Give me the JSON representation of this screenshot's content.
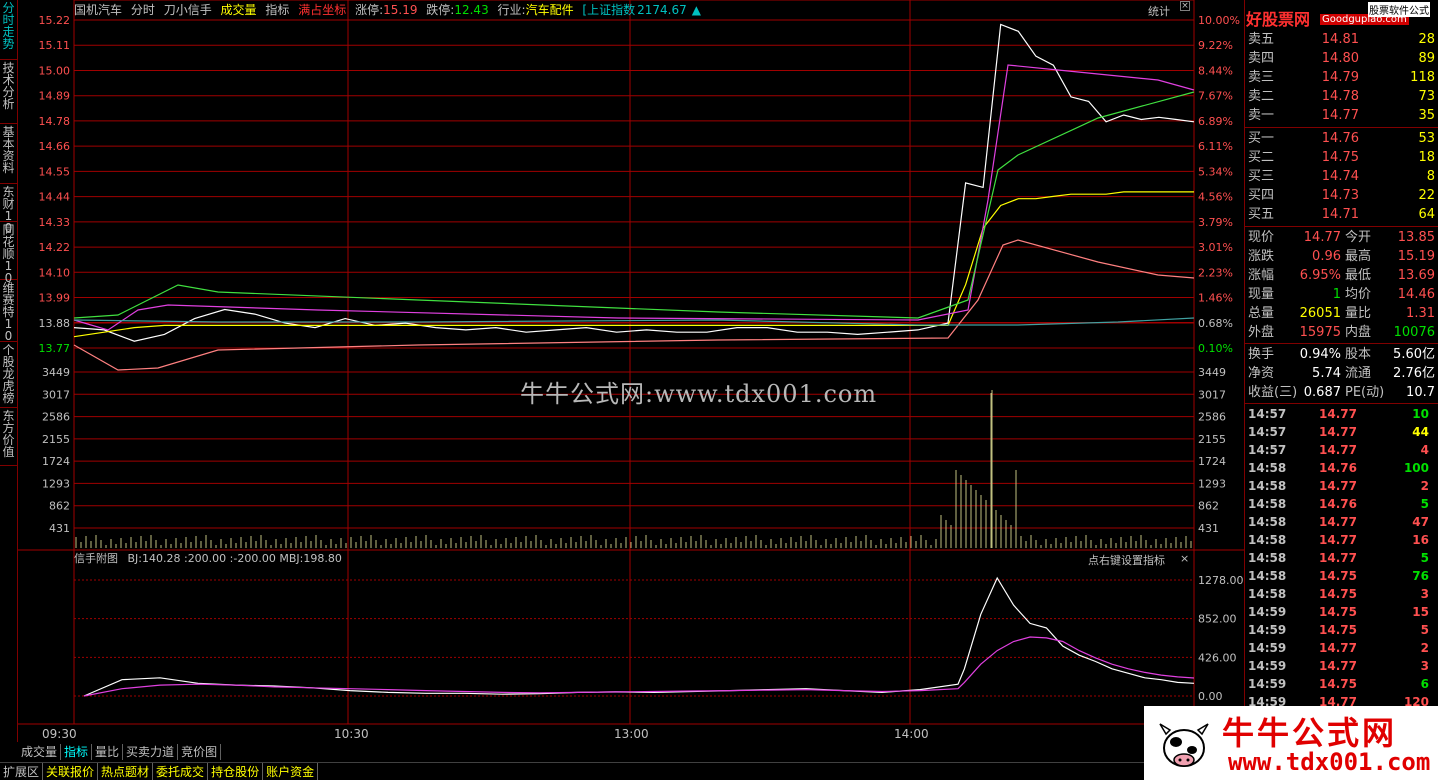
{
  "stock": {
    "name": "国机汽车",
    "mode": "分时",
    "indicator_name": "刀小信手",
    "volume_label": "成交量",
    "index_label": "指标",
    "full_coord": "满占坐标",
    "limit_up_label": "涨停:",
    "limit_up": "15.19",
    "limit_down_label": "跌停:",
    "limit_down": "12.43",
    "industry_label": "行业:",
    "industry": "汽车配件",
    "index_ref": "[上证指数",
    "index_value": "2174.67",
    "stats_label": "统计"
  },
  "left_tabs": [
    {
      "label": "分时走势",
      "active": true
    },
    {
      "label": "技术分析",
      "active": false
    },
    {
      "label": "基本资料",
      "active": false
    },
    {
      "label": "东财10",
      "active": false
    },
    {
      "label": "同花顺10",
      "active": false
    },
    {
      "label": "维赛特10",
      "active": false
    },
    {
      "label": "个股龙虎榜",
      "active": false
    },
    {
      "label": "东方价值",
      "active": false
    }
  ],
  "sub_indicator": {
    "title": "信手附图",
    "values": "BJ:140.28  :200.00  :-200.00  MBJ:198.80",
    "right_hint": "点右键设置指标",
    "close": "×"
  },
  "quotes": {
    "asks": [
      {
        "label": "卖五",
        "price": "14.81",
        "vol": "28"
      },
      {
        "label": "卖四",
        "price": "14.80",
        "vol": "89"
      },
      {
        "label": "卖三",
        "price": "14.79",
        "vol": "118"
      },
      {
        "label": "卖二",
        "price": "14.78",
        "vol": "73"
      },
      {
        "label": "卖一",
        "price": "14.77",
        "vol": "35"
      }
    ],
    "bids": [
      {
        "label": "买一",
        "price": "14.76",
        "vol": "53"
      },
      {
        "label": "买二",
        "price": "14.75",
        "vol": "18"
      },
      {
        "label": "买三",
        "price": "14.74",
        "vol": "8"
      },
      {
        "label": "买四",
        "price": "14.73",
        "vol": "22"
      },
      {
        "label": "买五",
        "price": "14.71",
        "vol": "64"
      }
    ]
  },
  "stats": [
    {
      "k1": "现价",
      "v1": "14.77",
      "c1": "red",
      "k2": "今开",
      "v2": "13.85",
      "c2": "red"
    },
    {
      "k1": "涨跌",
      "v1": "0.96",
      "c1": "red",
      "k2": "最高",
      "v2": "15.19",
      "c2": "red"
    },
    {
      "k1": "涨幅",
      "v1": "6.95%",
      "c1": "red",
      "k2": "最低",
      "v2": "13.69",
      "c2": "red"
    },
    {
      "k1": "现量",
      "v1": "1",
      "c1": "green",
      "k2": "均价",
      "v2": "14.46",
      "c2": "red"
    },
    {
      "k1": "总量",
      "v1": "26051",
      "c1": "yellow",
      "k2": "量比",
      "v2": "1.31",
      "c2": "red"
    },
    {
      "k1": "外盘",
      "v1": "15975",
      "c1": "red",
      "k2": "内盘",
      "v2": "10076",
      "c2": "green"
    }
  ],
  "stats2": [
    {
      "k1": "换手",
      "v1": "0.94%",
      "k2": "股本",
      "v2": "5.60亿"
    },
    {
      "k1": "净资",
      "v1": "5.74",
      "k2": "流通",
      "v2": "2.76亿"
    },
    {
      "k1": "收益(三)",
      "v1": "0.687",
      "k2": "PE(动)",
      "v2": "10.7"
    }
  ],
  "ticks": [
    {
      "t": "14:57",
      "p": "14.77",
      "v": "10",
      "vc": "green"
    },
    {
      "t": "14:57",
      "p": "14.77",
      "v": "44",
      "vc": "yellow"
    },
    {
      "t": "14:57",
      "p": "14.77",
      "v": "4",
      "vc": "red"
    },
    {
      "t": "14:58",
      "p": "14.76",
      "v": "100",
      "vc": "green"
    },
    {
      "t": "14:58",
      "p": "14.77",
      "v": "2",
      "vc": "red"
    },
    {
      "t": "14:58",
      "p": "14.76",
      "v": "5",
      "vc": "green"
    },
    {
      "t": "14:58",
      "p": "14.77",
      "v": "47",
      "vc": "red"
    },
    {
      "t": "14:58",
      "p": "14.77",
      "v": "16",
      "vc": "red"
    },
    {
      "t": "14:58",
      "p": "14.77",
      "v": "5",
      "vc": "green"
    },
    {
      "t": "14:58",
      "p": "14.75",
      "v": "76",
      "vc": "green"
    },
    {
      "t": "14:58",
      "p": "14.75",
      "v": "3",
      "vc": "red"
    },
    {
      "t": "14:59",
      "p": "14.75",
      "v": "15",
      "vc": "red"
    },
    {
      "t": "14:59",
      "p": "14.75",
      "v": "5",
      "vc": "red"
    },
    {
      "t": "14:59",
      "p": "14.77",
      "v": "2",
      "vc": "red"
    },
    {
      "t": "14:59",
      "p": "14.77",
      "v": "3",
      "vc": "red"
    },
    {
      "t": "14:59",
      "p": "14.75",
      "v": "6",
      "vc": "green"
    },
    {
      "t": "14:59",
      "p": "14.77",
      "v": "120",
      "vc": "red"
    }
  ],
  "bottom_tabs1": [
    "成交量",
    "指标",
    "量比",
    "买卖力道",
    "竞价图"
  ],
  "bottom_tabs2": [
    "扩展区",
    "关联报价",
    "热点题材",
    "委托成交",
    "持仓股份",
    "账户资金"
  ],
  "watermark": "牛牛公式网:www.tdx001.com",
  "brand": {
    "top": "好股票网",
    "top_url": "Goodgupiao.com",
    "top_right": "股票软件公式",
    "bottom_cn": "牛牛公式网",
    "bottom_url": "www.tdx001.com"
  },
  "colors": {
    "grid": "#a00000",
    "price": "#ffffff",
    "avg": "#ffff00",
    "up": "#ff5050",
    "down": "#00e000"
  },
  "chart_data": [
    {
      "type": "line",
      "title": "",
      "x": [
        "09:30",
        "10:30",
        "13:00",
        "14:00"
      ],
      "y_ticks_left": [
        "15.22",
        "15.11",
        "15.00",
        "14.89",
        "14.78",
        "14.66",
        "14.55",
        "14.44",
        "14.33",
        "14.22",
        "14.10",
        "13.99",
        "13.88",
        "13.77"
      ],
      "y_ticks_right": [
        "10.00%",
        "9.22%",
        "8.44%",
        "7.67%",
        "6.89%",
        "6.11%",
        "5.34%",
        "4.56%",
        "3.79%",
        "3.01%",
        "2.23%",
        "1.46%",
        "0.68%",
        "0.10%"
      ],
      "ylim": [
        13.77,
        15.22
      ],
      "series": [
        {
          "values": [
            13.86,
            13.85,
            13.8,
            13.83,
            13.9,
            13.94,
            13.92,
            13.88,
            13.86,
            13.9,
            13.87,
            13.88,
            13.86,
            13.85,
            13.86,
            13.84,
            13.85,
            13.86,
            13.84,
            13.85,
            13.84,
            13.84,
            13.86,
            13.86,
            13.84,
            13.84,
            13.83,
            13.84,
            13.85,
            13.88,
            14.5,
            14.48,
            15.2,
            15.17,
            15.06,
            15.02,
            14.88,
            14.86,
            14.77,
            14.8,
            14.78,
            14.79,
            14.78,
            14.77
          ]
        },
        {
          "values": [
            13.82,
            13.84,
            13.86,
            13.87,
            13.87,
            13.87,
            13.87,
            13.87,
            13.87,
            13.87,
            13.87,
            13.87,
            13.87,
            13.87,
            13.87,
            13.87,
            13.87,
            13.87,
            13.87,
            13.87,
            13.87,
            13.87,
            13.87,
            13.87,
            13.87,
            13.87,
            13.87,
            13.87,
            13.87,
            13.87,
            14.05,
            14.3,
            14.4,
            14.43,
            14.43,
            14.44,
            14.45,
            14.45,
            14.45,
            14.46,
            14.46,
            14.46,
            14.46,
            14.46
          ]
        }
      ]
    },
    {
      "type": "bar",
      "title": "成交量",
      "y_ticks": [
        "3449",
        "3017",
        "2586",
        "2155",
        "1724",
        "1293",
        "862",
        "431"
      ],
      "ylim": [
        0,
        3449
      ]
    },
    {
      "type": "line",
      "title": "信手附图",
      "y_ticks": [
        "1278.00",
        "852.00",
        "426.00",
        "0.00"
      ],
      "ylim": [
        0,
        1278
      ],
      "series": [
        {
          "name": "BJ",
          "values": [
            0,
            180,
            200,
            140,
            120,
            110,
            90,
            60,
            40,
            30,
            30,
            20,
            25,
            40,
            45,
            40,
            50,
            60,
            70,
            80,
            60,
            40,
            70,
            130,
            300,
            900,
            1300,
            1000,
            800,
            750,
            550,
            450,
            380,
            300,
            250,
            200,
            180,
            150,
            140
          ]
        },
        {
          "name": "MBJ",
          "values": [
            0,
            80,
            120,
            130,
            120,
            100,
            90,
            80,
            70,
            60,
            50,
            40,
            35,
            40,
            45,
            50,
            55,
            60,
            65,
            70,
            60,
            50,
            60,
            80,
            150,
            350,
            500,
            600,
            650,
            640,
            600,
            500,
            420,
            350,
            300,
            260,
            230,
            210,
            198
          ]
        }
      ]
    }
  ]
}
